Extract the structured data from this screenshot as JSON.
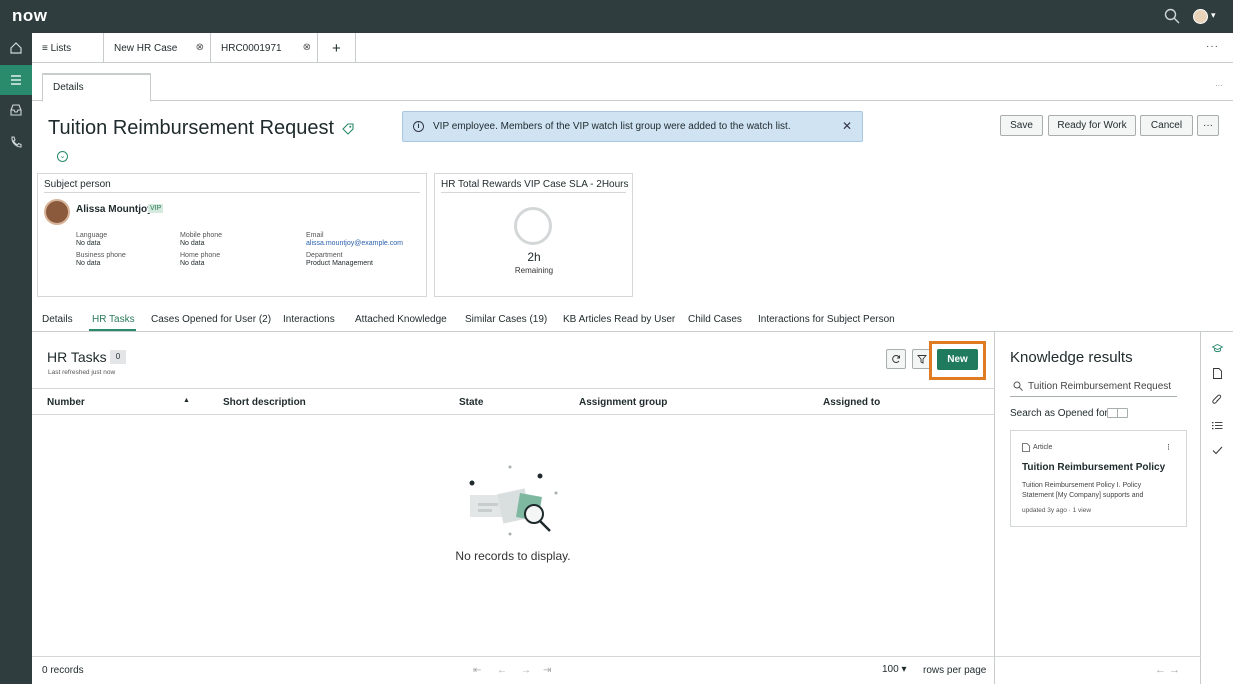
{
  "header": {
    "logo": "now",
    "search_icon": "search-icon",
    "user_menu_caret": "▾"
  },
  "left_rail": {
    "items": [
      "home-icon",
      "list-icon",
      "inbox-icon",
      "phone-icon"
    ],
    "active": "list-icon"
  },
  "tabs": {
    "items": [
      {
        "label": "≡ Lists"
      },
      {
        "label": "New HR Case",
        "close": "⊗"
      },
      {
        "label": "HRC0001971",
        "close": "⊗"
      }
    ],
    "add": "+",
    "more": "···"
  },
  "details_tab": {
    "label": "Details",
    "more": "···"
  },
  "record": {
    "title": "Tuition Reimbursement Request",
    "banner": "VIP employee. Members of the VIP watch list group were added to the watch list.",
    "banner_info": "i",
    "banner_close": "✕",
    "actions": {
      "save": "Save",
      "ready": "Ready for Work",
      "cancel": "Cancel",
      "more": "···"
    }
  },
  "subject_card": {
    "title": "Subject person",
    "name": "Alissa Mountjoy",
    "vip": "VIP",
    "fields": {
      "language_label": "Language",
      "language_value": "No data",
      "mobile_label": "Mobile phone",
      "mobile_value": "No data",
      "email_label": "Email",
      "email_value": "alissa.mountjoy@example.com",
      "business_label": "Business phone",
      "business_value": "No data",
      "home_label": "Home phone",
      "home_value": "No data",
      "department_label": "Department",
      "department_value": "Product Management"
    }
  },
  "sla_card": {
    "title": "HR Total Rewards VIP Case SLA - 2Hours",
    "value": "2h",
    "remaining": "Remaining"
  },
  "related_tabs": {
    "items": [
      "Details",
      "HR Tasks",
      "Cases Opened for User (2)",
      "Interactions",
      "Attached Knowledge",
      "Similar Cases (19)",
      "KB Articles Read by User",
      "Child Cases",
      "Interactions for Subject Person"
    ],
    "active": "HR Tasks"
  },
  "hr_tasks": {
    "title": "HR Tasks",
    "count": "0",
    "refreshed": "Last refreshed just now",
    "new_label": "New",
    "columns": [
      "Number",
      "Short description",
      "State",
      "Assignment group",
      "Assigned to"
    ],
    "sort_indicator": "▲",
    "empty": "No records to display.",
    "record_count": "0 records",
    "pager": [
      "⇤",
      "←",
      "→",
      "⇥"
    ],
    "per_page": "100 ▾",
    "rows_per_page": "rows per page"
  },
  "knowledge": {
    "title": "Knowledge results",
    "search_value": "Tuition Reimbursement Request",
    "toggle_label": "Search as Opened for",
    "article": {
      "type": "Article",
      "kebab": "⁝",
      "title": "Tuition Reimbursement Policy",
      "snippet": "Tuition Reimbursement Policy I. Policy Statement [My Company] supports and",
      "meta": "updated 3y ago · 1 view"
    },
    "nav": "←  →"
  },
  "right_rail": [
    "graduation-cap-icon",
    "document-icon",
    "paperclip-icon",
    "checklist-icon",
    "checkmark-icon"
  ],
  "colors": {
    "header_bg": "#2f3d3f",
    "accent": "#1f7a5e",
    "highlight": "#e07b24",
    "banner_bg": "#cfe3f3"
  }
}
